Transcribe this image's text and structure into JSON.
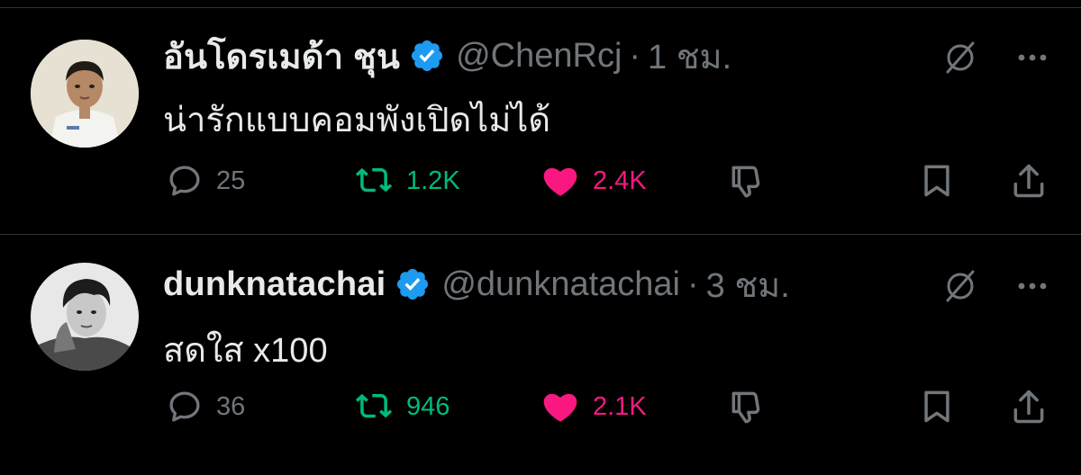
{
  "colors": {
    "background": "#000000",
    "text": "#e7e9ea",
    "muted": "#71767b",
    "divider": "#2f3336",
    "verified": "#1d9bf0",
    "retweet": "#00ba7c",
    "like": "#f91880"
  },
  "tweets": [
    {
      "display_name": "อันโดรเมด้า ชุน",
      "handle": "@ChenRcj",
      "separator": "·",
      "time": "1 ชม.",
      "verified_icon": "verified-badge-icon",
      "text": "น่ารักแบบคอมพังเปิดไม่ได้",
      "replies": "25",
      "retweets": "1.2K",
      "likes": "2.4K",
      "liked": true
    },
    {
      "display_name": "dunknatachai",
      "handle": "@dunknatachai",
      "separator": "·",
      "time": "3 ชม.",
      "verified_icon": "verified-badge-icon",
      "text": "สดใส x100",
      "replies": "36",
      "retweets": "946",
      "likes": "2.1K",
      "liked": true
    }
  ],
  "icons": {
    "reply": "reply-bubble-icon",
    "retweet": "retweet-icon",
    "like": "heart-icon",
    "dislike": "thumbs-down-icon",
    "bookmark": "bookmark-icon",
    "share": "share-upload-icon",
    "grok": "grok-slash-circle-icon",
    "more": "ellipsis-icon"
  }
}
